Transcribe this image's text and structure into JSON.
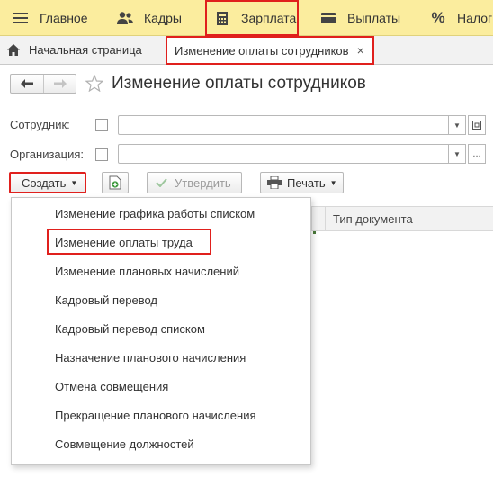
{
  "sections": [
    {
      "label": "Главное",
      "icon": "hamburger-icon"
    },
    {
      "label": "Кадры",
      "icon": "people-icon"
    },
    {
      "label": "Зарплата",
      "icon": "calculator-icon"
    },
    {
      "label": "Выплаты",
      "icon": "wallet-icon"
    },
    {
      "label": "Налог",
      "icon": "percent-icon"
    }
  ],
  "tabs": {
    "home": "Начальная страница",
    "active": "Изменение оплаты сотрудников",
    "close": "×"
  },
  "form": {
    "title": "Изменение оплаты сотрудников",
    "employee_label": "Сотрудник:",
    "organization_label": "Организация:",
    "employee_value": "",
    "organization_value": "",
    "ext_button": "..."
  },
  "commands": {
    "create": "Создать",
    "approve": "Утвердить",
    "print": "Печать"
  },
  "table": {
    "columns": [
      "Тип документа"
    ]
  },
  "menu": {
    "items": [
      "Изменение графика работы списком",
      "Изменение оплаты труда",
      "Изменение плановых начислений",
      "Кадровый перевод",
      "Кадровый перевод списком",
      "Назначение планового начисления",
      "Отмена совмещения",
      "Прекращение планового начисления",
      "Совмещение должностей"
    ],
    "highlighted_index": 1
  },
  "colors": {
    "section_bar": "#fbed9e",
    "highlight": "#e0201d",
    "tab_bar": "#f2f2f2"
  }
}
